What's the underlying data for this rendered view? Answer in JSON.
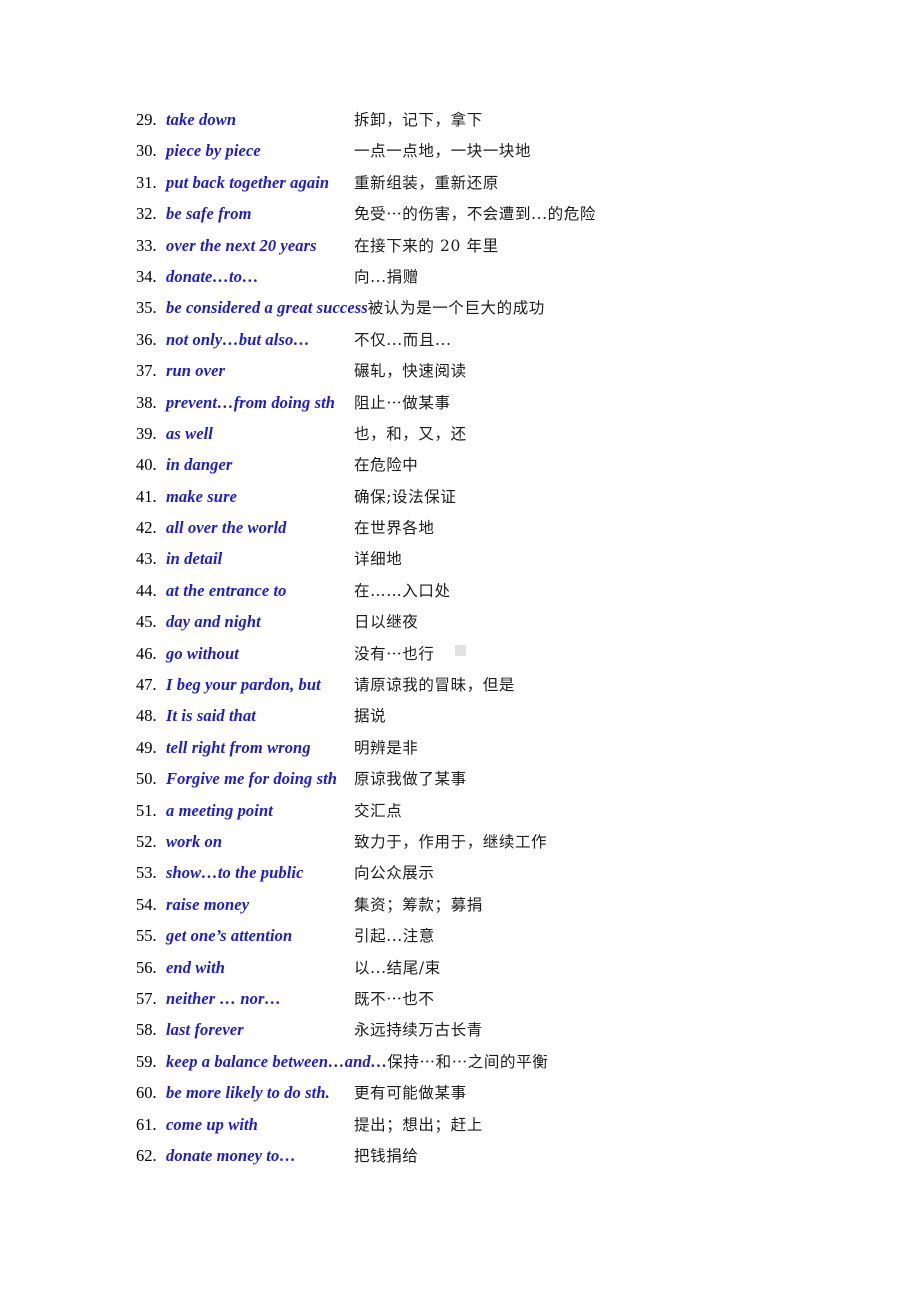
{
  "document": {
    "type": "vocabulary-phrase-list",
    "language_pair": "English-Chinese",
    "page_background": "#ffffff",
    "english_color": "#1a1ae0",
    "number_color": "#000000",
    "chinese_color": "#1c1c1c",
    "start_number": 29,
    "end_number": 62
  },
  "entries": [
    {
      "num": "29.",
      "en": "take down",
      "zh": "拆卸，记下，拿下",
      "layout": "cols"
    },
    {
      "num": "30.",
      "en": "piece by piece",
      "zh": "一点一点地，一块一块地",
      "layout": "cols"
    },
    {
      "num": "31.",
      "en": "put back together again",
      "zh": "重新组装，重新还原",
      "layout": "cols"
    },
    {
      "num": "32.",
      "en": "be safe from",
      "zh": "免受⋯的伤害，不会遭到...的危险",
      "layout": "cols"
    },
    {
      "num": "33.",
      "en": "over the next 20 years",
      "zh": "在接下来的 20 年里",
      "layout": "cols"
    },
    {
      "num": "34.",
      "en": "donate…to…",
      "zh": "向...捐赠",
      "layout": "cols"
    },
    {
      "num": "35.",
      "en": "be considered a great success",
      "zh": "被认为是一个巨大的成功",
      "layout": "flow"
    },
    {
      "num": "36.",
      "en": "not only…but also…",
      "zh": "不仅...而且...",
      "layout": "cols"
    },
    {
      "num": "37.",
      "en": "run over",
      "zh": "碾轧，快速阅读",
      "layout": "cols"
    },
    {
      "num": "38.",
      "en": "prevent…from doing sth",
      "zh": "阻止⋯做某事",
      "layout": "cols"
    },
    {
      "num": "39.",
      "en": "as well",
      "zh": "也，和，又，还",
      "layout": "cols"
    },
    {
      "num": "40.",
      "en": "in danger",
      "zh": "在危险中",
      "layout": "cols"
    },
    {
      "num": "41.",
      "en": "make sure",
      "zh": "确保;设法保证",
      "layout": "cols"
    },
    {
      "num": "42.",
      "en": "all over the world",
      "zh": "在世界各地",
      "layout": "cols"
    },
    {
      "num": "43.",
      "en": "in detail",
      "zh": "详细地",
      "layout": "cols"
    },
    {
      "num": "44.",
      "en": "at the entrance to",
      "zh": "在……入口处",
      "layout": "cols"
    },
    {
      "num": "45.",
      "en": "day and night",
      "zh": "日以继夜",
      "layout": "cols"
    },
    {
      "num": "46.",
      "en": "go without",
      "zh": "没有⋯也行",
      "layout": "cols"
    },
    {
      "num": "47.",
      "en": "I beg your pardon, but",
      "zh": "请原谅我的冒昧，但是",
      "layout": "cols"
    },
    {
      "num": "48.",
      "en": "It is said that",
      "zh": "据说",
      "layout": "cols"
    },
    {
      "num": "49.",
      "en": "tell right from wrong",
      "zh": "明辨是非",
      "layout": "cols"
    },
    {
      "num": "50.",
      "en": "Forgive me for doing sth",
      "zh": "原谅我做了某事",
      "layout": "cols"
    },
    {
      "num": "51.",
      "en": "a meeting point",
      "zh": "交汇点",
      "layout": "cols"
    },
    {
      "num": "52.",
      "en": "work on",
      "zh": "致力于，作用于，继续工作",
      "layout": "cols"
    },
    {
      "num": "53.",
      "en": "show…to the public",
      "zh": "向公众展示",
      "layout": "cols"
    },
    {
      "num": "54.",
      "en": "raise money",
      "zh": "集资；筹款；募捐",
      "layout": "cols"
    },
    {
      "num": "55.",
      "en": "get one’s attention",
      "zh": "引起...注意",
      "layout": "cols"
    },
    {
      "num": "56.",
      "en": "end with",
      "zh": "以...结尾/束",
      "layout": "cols"
    },
    {
      "num": "57.",
      "en": "neither … nor…",
      "zh": "既不⋯也不",
      "layout": "cols"
    },
    {
      "num": "58.",
      "en": "last forever",
      "zh": "永远持续万古长青",
      "layout": "cols"
    },
    {
      "num": "59.",
      "en": "keep a  balance between…and…",
      "zh": "保持⋯和⋯之间的平衡",
      "layout": "flow"
    },
    {
      "num": "60.",
      "en": "be more likely to do sth.",
      "zh": "更有可能做某事",
      "layout": "cols"
    },
    {
      "num": "61.",
      "en": "come up with",
      "zh": "提出；想出；赶上",
      "layout": "cols"
    },
    {
      "num": "62.",
      "en": "donate money to…",
      "zh": "把钱捐给",
      "layout": "cols"
    }
  ]
}
